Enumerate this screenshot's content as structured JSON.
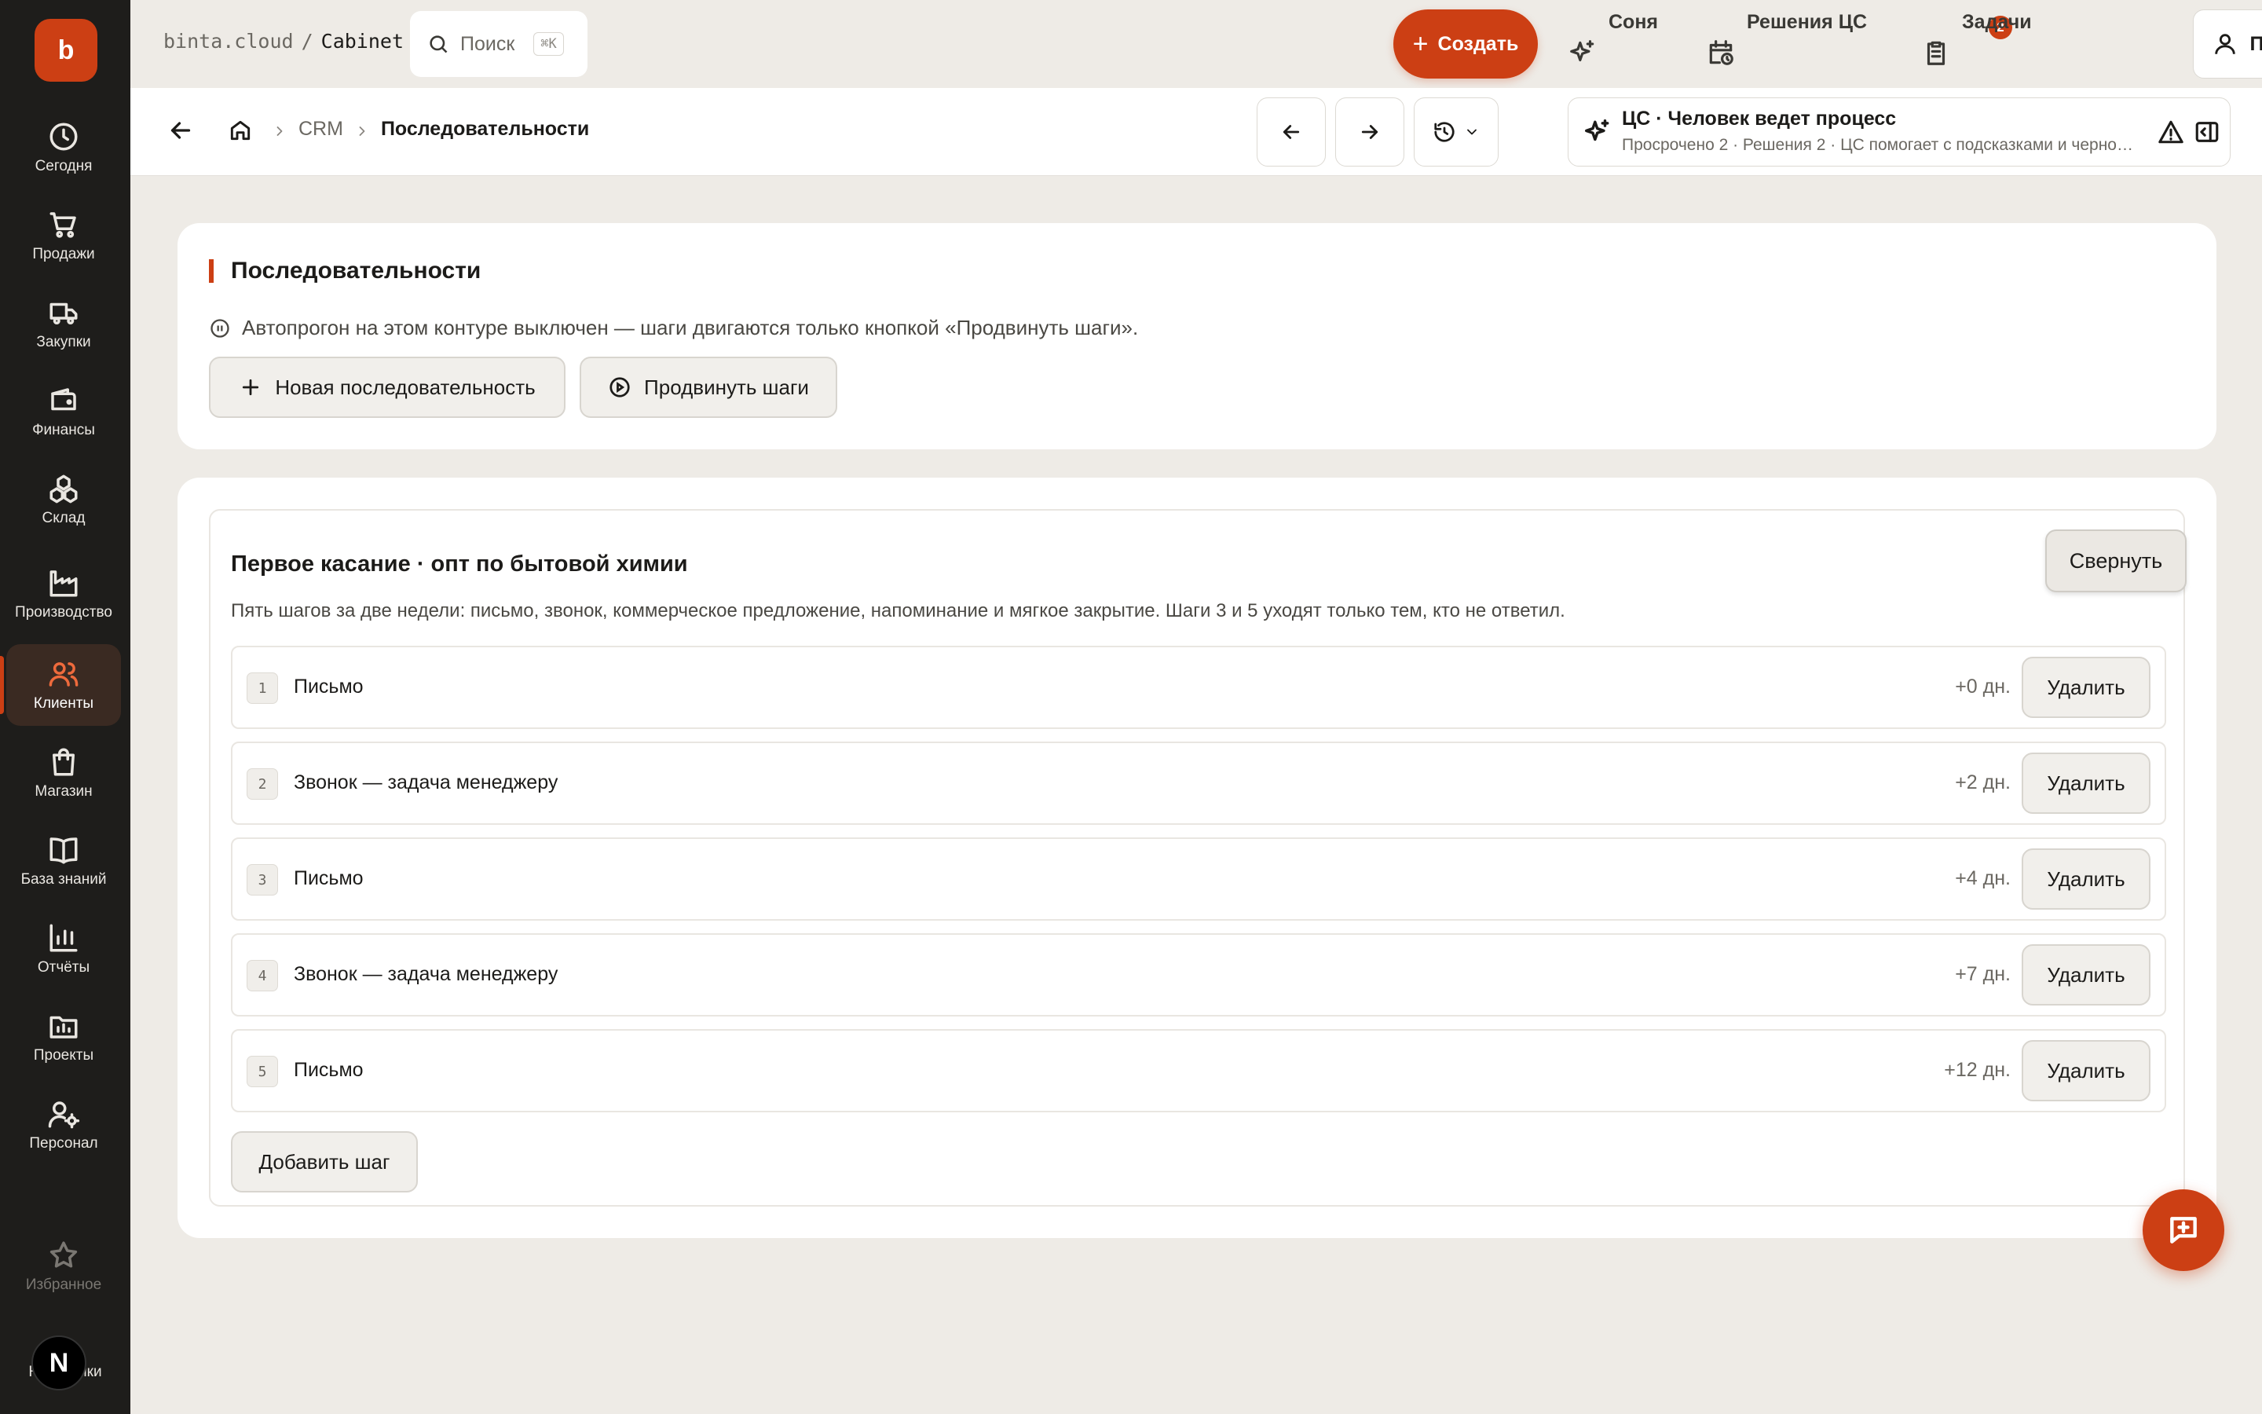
{
  "sidebar": {
    "logo": "b",
    "items": [
      {
        "label": "Сегодня",
        "icon": "clock-icon"
      },
      {
        "label": "Продажи",
        "icon": "cart-icon"
      },
      {
        "label": "Закупки",
        "icon": "truck-icon"
      },
      {
        "label": "Финансы",
        "icon": "wallet-icon"
      },
      {
        "label": "Склад",
        "icon": "boxes-icon"
      },
      {
        "label": "Производство",
        "icon": "factory-icon"
      },
      {
        "label": "Клиенты",
        "icon": "users-icon",
        "active": true
      },
      {
        "label": "Магазин",
        "icon": "bag-icon"
      },
      {
        "label": "База знаний",
        "icon": "book-icon"
      },
      {
        "label": "Отчёты",
        "icon": "chart-icon"
      },
      {
        "label": "Проекты",
        "icon": "folder-icon"
      },
      {
        "label": "Персонал",
        "icon": "user-gear-icon"
      }
    ],
    "favorites": "Избранное",
    "settings": "Настройки",
    "next_badge": "N"
  },
  "topbar": {
    "brand": "binta.cloud",
    "separator": "/",
    "section": "Cabinet",
    "search_placeholder": "Поиск",
    "search_shortcut": "⌘K",
    "create_label": "Создать",
    "assistant_label": "Соня",
    "decisions_label": "Решения ЦС",
    "decisions_count": "2",
    "tasks_label": "Задачи",
    "profile_label": "Профиль"
  },
  "subheader": {
    "crumb_crm": "CRM",
    "crumb_current": "Последовательности",
    "cs_title": "ЦС · Человек ведет процесс",
    "cs_subtitle": "Просрочено 2 · Решения 2 · ЦС помогает с подсказками и черновиками"
  },
  "header_card": {
    "title": "Последовательности",
    "info": "Автопрогон на этом контуре выключен — шаги двигаются только кнопкой «Продвинуть шаги».",
    "new_sequence_label": "Новая последовательность",
    "advance_label": "Продвинуть шаги"
  },
  "sequence": {
    "title": "Первое касание · опт по бытовой химии",
    "collapse_label": "Свернуть",
    "description": "Пять шагов за две недели: письмо, звонок, коммерческое предложение, напоминание и мягкое закрытие. Шаги 3 и 5 уходят только тем, кто не ответил.",
    "delete_label": "Удалить",
    "add_step_label": "Добавить шаг",
    "steps": [
      {
        "num": "1",
        "name": "Письмо",
        "delay": "+0 дн."
      },
      {
        "num": "2",
        "name": "Звонок — задача менеджеру",
        "delay": "+2 дн."
      },
      {
        "num": "3",
        "name": "Письмо",
        "delay": "+4 дн."
      },
      {
        "num": "4",
        "name": "Звонок — задача менеджеру",
        "delay": "+7 дн."
      },
      {
        "num": "5",
        "name": "Письмо",
        "delay": "+12 дн."
      }
    ]
  },
  "colors": {
    "accent": "#cc3f14",
    "sidebar_bg": "#1e1d1b",
    "page_bg": "#eeebe6"
  }
}
